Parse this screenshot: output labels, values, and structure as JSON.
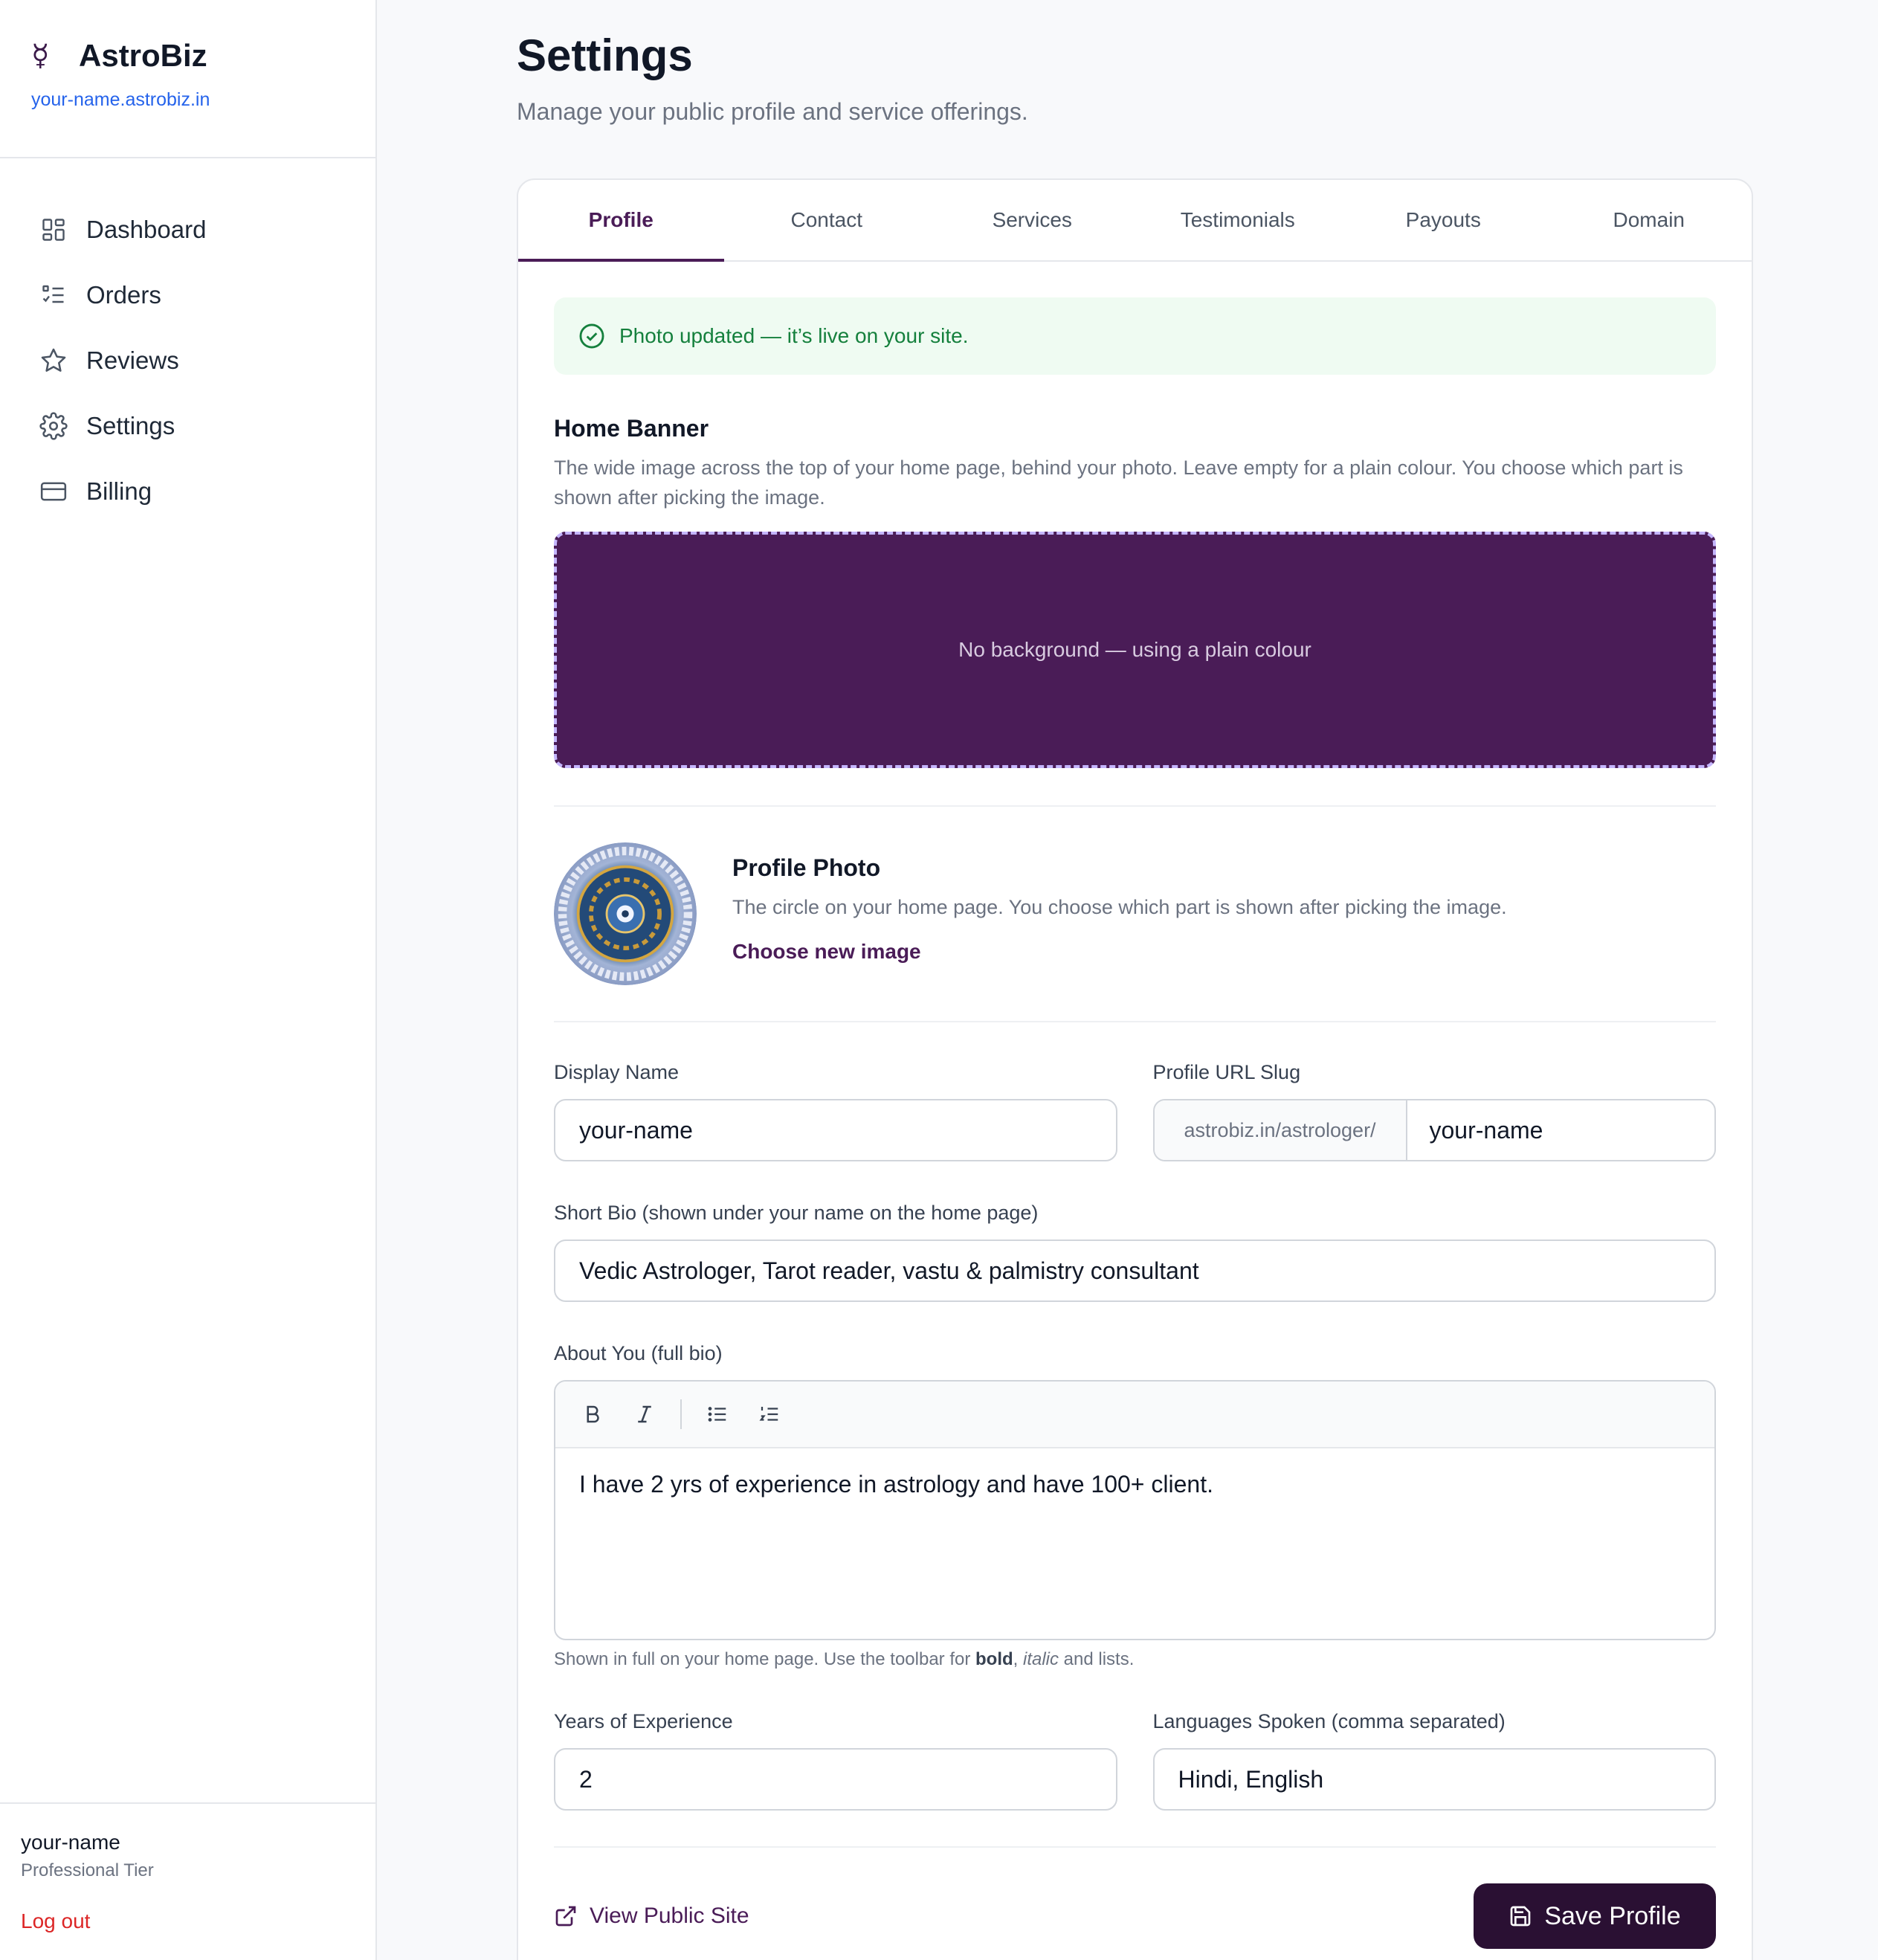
{
  "sidebar": {
    "brand_logo": "☿",
    "brand_name": "AstroBiz",
    "brand_url": "your-name.astrobiz.in",
    "items": [
      {
        "label": "Dashboard",
        "icon": "dashboard-icon"
      },
      {
        "label": "Orders",
        "icon": "orders-icon"
      },
      {
        "label": "Reviews",
        "icon": "star-icon"
      },
      {
        "label": "Settings",
        "icon": "gear-icon"
      },
      {
        "label": "Billing",
        "icon": "card-icon"
      }
    ],
    "user_name": "your-name",
    "user_tier": "Professional Tier",
    "logout_label": "Log out"
  },
  "header": {
    "title": "Settings",
    "subtitle": "Manage your public profile and service offerings."
  },
  "tabs": [
    {
      "label": "Profile",
      "active": true
    },
    {
      "label": "Contact"
    },
    {
      "label": "Services"
    },
    {
      "label": "Testimonials"
    },
    {
      "label": "Payouts"
    },
    {
      "label": "Domain"
    }
  ],
  "alert": {
    "text": "Photo updated — it’s live on your site."
  },
  "banner": {
    "title": "Home Banner",
    "desc": "The wide image across the top of your home page, behind your photo. Leave empty for a plain colour. You choose which part is shown after picking the image.",
    "placeholder": "No background — using a plain colour",
    "color": "#4a1c57"
  },
  "photo": {
    "title": "Profile Photo",
    "desc": "The circle on your home page. You choose which part is shown after picking the image.",
    "choose_label": "Choose new image"
  },
  "form": {
    "display_name_label": "Display Name",
    "display_name_value": "your-name",
    "slug_label": "Profile URL Slug",
    "slug_prefix": "astrobiz.in/astrologer/",
    "slug_value": "your-name",
    "short_bio_label": "Short Bio (shown under your name on the home page)",
    "short_bio_value": "Vedic Astrologer, Tarot reader, vastu & palmistry consultant",
    "about_label": "About You (full bio)",
    "about_value": "I have 2 yrs of experience in astrology and have 100+ client.",
    "about_hint_1": "Shown in full on your home page. Use the toolbar for ",
    "about_hint_bold": "bold",
    "about_hint_2": ", ",
    "about_hint_italic": "italic",
    "about_hint_3": " and lists.",
    "years_label": "Years of Experience",
    "years_value": "2",
    "languages_label": "Languages Spoken (comma separated)",
    "languages_value": "Hindi, English"
  },
  "actions": {
    "view_site_label": "View Public Site",
    "save_label": "Save Profile"
  },
  "colors": {
    "accent": "#4a1c57",
    "save_button": "#2a1033",
    "success": "#15803d",
    "danger": "#dc2626",
    "link": "#2563eb"
  }
}
